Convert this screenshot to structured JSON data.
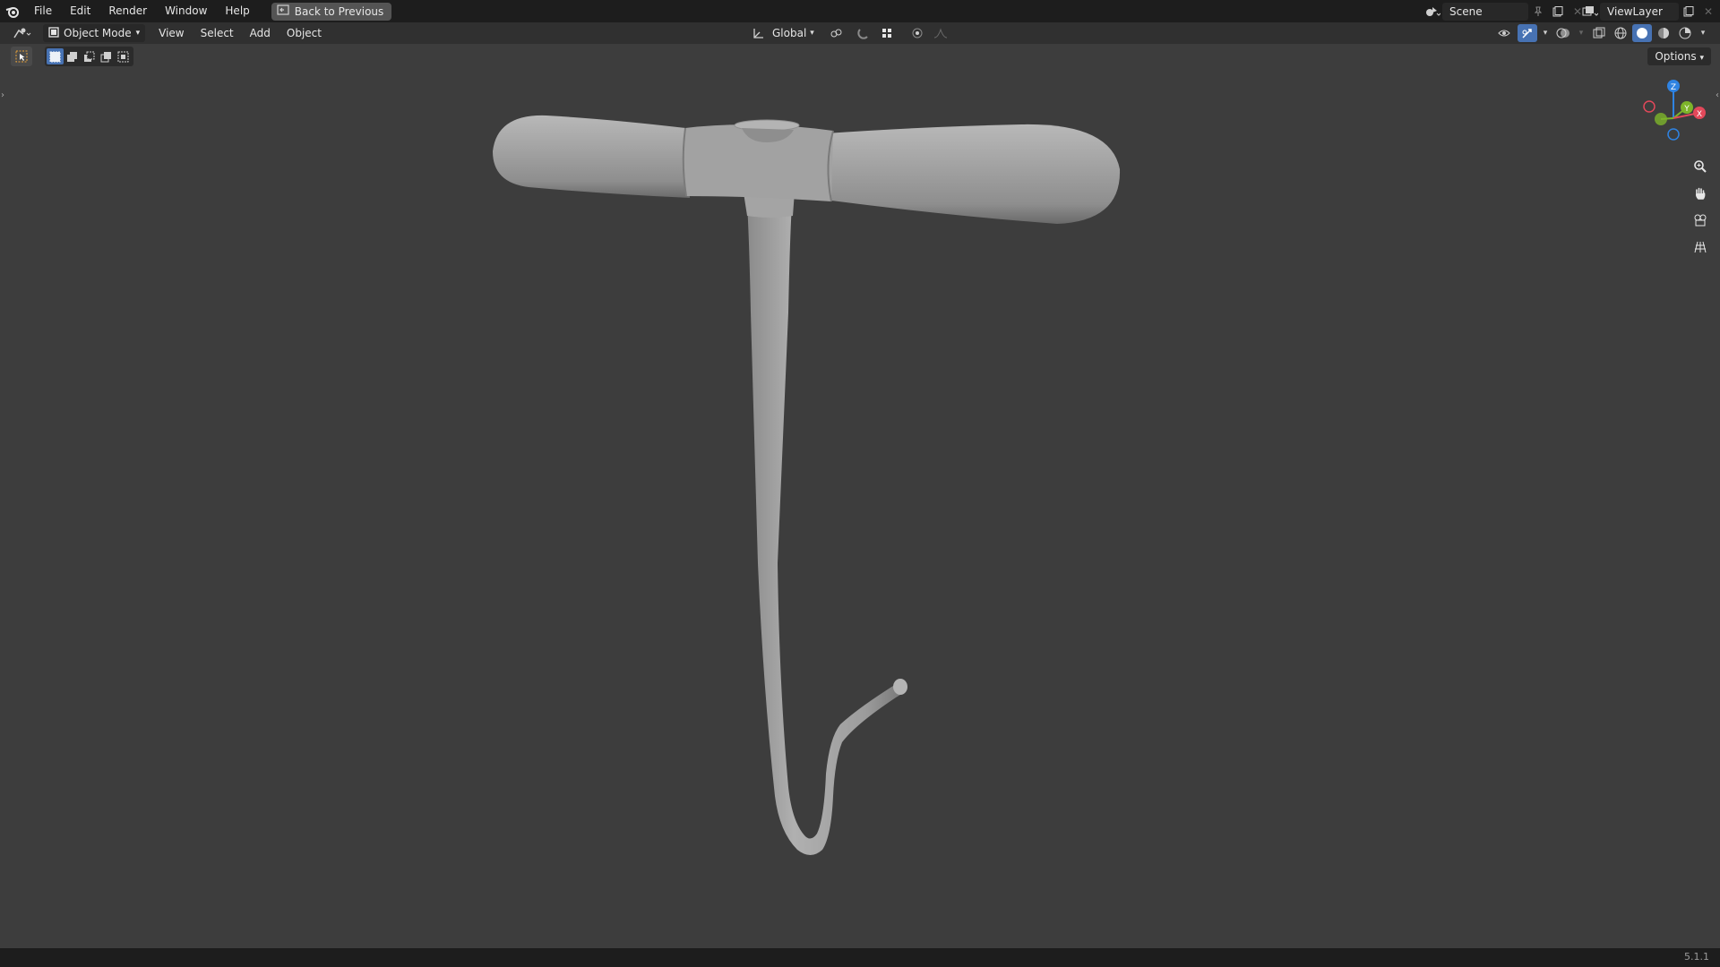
{
  "topbar": {
    "menu": [
      "File",
      "Edit",
      "Render",
      "Window",
      "Help"
    ],
    "back_button": "Back to Previous",
    "scene_name": "Scene",
    "view_layer_name": "ViewLayer"
  },
  "header": {
    "mode": "Object Mode",
    "menu": [
      "View",
      "Select",
      "Add",
      "Object"
    ],
    "transform_orientation": "Global",
    "options_label": "Options"
  },
  "gizmo": {
    "z_label": "Z",
    "y_label": "Y",
    "x_label": "X",
    "colors": {
      "x": "#e2485a",
      "y": "#7db42a",
      "z": "#2f83e2"
    }
  },
  "icons": {
    "logo": "blender-logo-icon",
    "zoom": "zoom-icon",
    "pan": "hand-pan-icon",
    "camera": "camera-view-icon",
    "ortho": "grid-ortho-icon"
  },
  "status": {
    "version": "5.1.1"
  }
}
